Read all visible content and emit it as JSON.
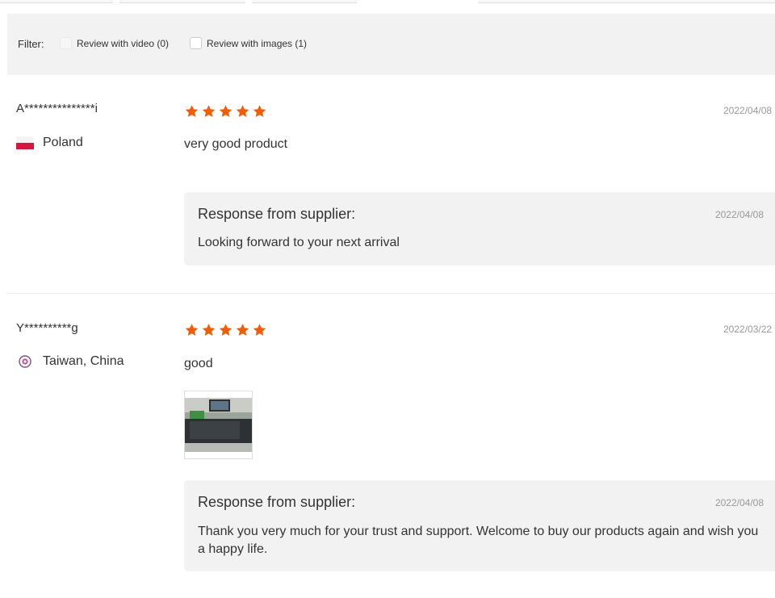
{
  "filter": {
    "label": "Filter:",
    "options": [
      {
        "label": "Review with video (0)",
        "checked": false
      },
      {
        "label": "Review with images (1)",
        "checked": false
      }
    ]
  },
  "reviews": [
    {
      "buyer": "A***************i",
      "country": "Poland",
      "rating": 5,
      "date": "2022/04/08",
      "text": "very good product",
      "images": [],
      "supplier_response": {
        "title": "Response from supplier:",
        "date": "2022/04/08",
        "text": "Looking forward to your next arrival"
      }
    },
    {
      "buyer": "Y**********g",
      "country": "Taiwan, China",
      "rating": 5,
      "date": "2022/03/22",
      "text": "good",
      "images": [
        "review-photo"
      ],
      "supplier_response": {
        "title": "Response from supplier:",
        "date": "2022/04/08",
        "text": "Thank you very much for your trust and support. Welcome to buy our products again and wish you a happy life."
      }
    }
  ],
  "colors": {
    "star": "#f25c05",
    "panel": "#f2f2f2",
    "muted": "#999999"
  },
  "icons": {
    "star": "star-icon",
    "flag_pl": "poland-flag-icon",
    "flag_tw": "taiwan-flag-icon"
  }
}
